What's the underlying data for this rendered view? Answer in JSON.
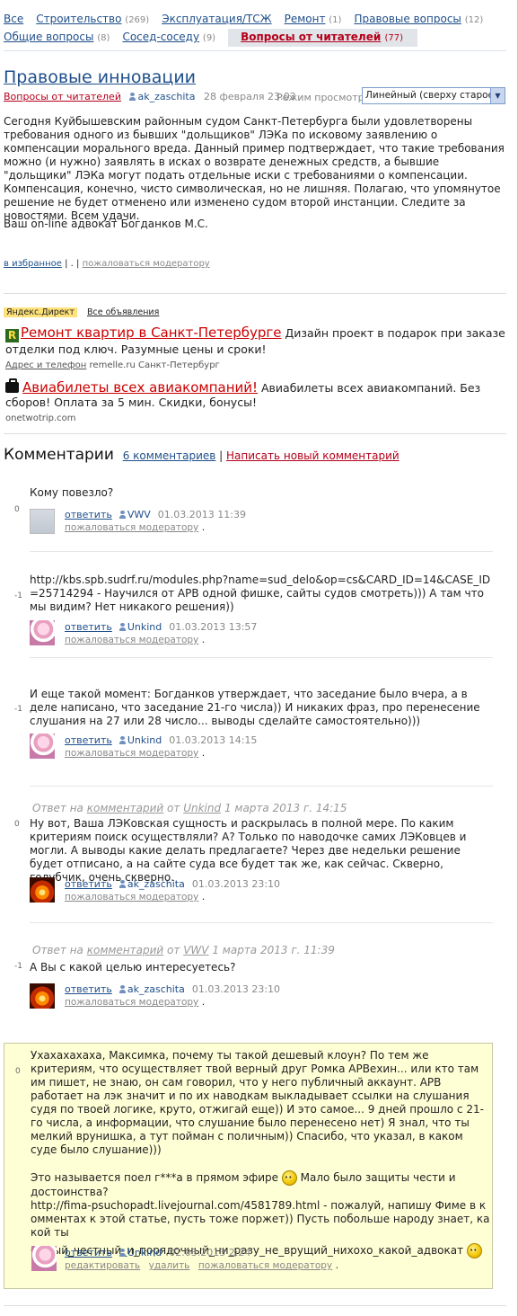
{
  "nav": {
    "items": [
      {
        "label": "Все",
        "count": ""
      },
      {
        "label": "Строительство",
        "count": "(269)"
      },
      {
        "label": "Эксплуатация/ТСЖ",
        "count": ""
      },
      {
        "label": "Ремонт",
        "count": "(1)"
      },
      {
        "label": "Правовые вопросы",
        "count": "(12)"
      },
      {
        "label": "Общие вопросы",
        "count": "(8)"
      },
      {
        "label": "Сосед-соседу",
        "count": "(9)"
      },
      {
        "label": "Вопросы от читателей",
        "count": "(77)"
      }
    ]
  },
  "article": {
    "title": "Правовые инновации",
    "rubric": "Вопросы от читателей",
    "author": "ak_zaschita",
    "date": "28 февраля 23:03",
    "view_mode_label": "Режим просмотра:",
    "view_mode_value": "Линейный (сверху старое)",
    "body": "Сегодня Куйбышевским районным судом Санкт-Петербурга были удовлетворены требования одного из бывших \"дольщиков\" ЛЭКа по исковому заявлению о компенсации морального вреда. Данный пример подтверждает, что такие требования можно (и нужно) заявлять в исках о возврате денежных средств, а бывшие \"дольщики\" ЛЭКа могут подать отдельные иски с требованиями о компенсации. Компенсация, конечно, чисто символическая, но не лишняя. Полагаю, что упомянутое решение не будет отменено или изменено судом второй инстанции. Следите за новостями. Всем удачи.",
    "signature": "Ваш on-line адвокат Богданков М.С.",
    "favorite_link": "в избранное",
    "sep1": "|",
    "dot": ".",
    "sep2": "|",
    "report_link": "пожаловаться модератору"
  },
  "ads": {
    "header": "Яндекс.Директ",
    "all_ads": "Все объявления",
    "items": [
      {
        "icon": "r-logo-icon",
        "title": "Ремонт квартир в Санкт-Петербурге",
        "text": "Дизайн проект в подарок при заказе отделки под ключ. Разумные цены и сроки!",
        "sub_link": "Адрес и телефон",
        "domain": "remelle.ru Санкт-Петербург"
      },
      {
        "icon": "briefcase-icon",
        "title": "Авиабилеты всех авиакомпаний!",
        "text": "Авиабилеты всех авиакомпаний. Без сборов! Оплата за 5 мин. Скидки, бонусы!",
        "sub_link": "",
        "domain": "onetwotrip.com"
      }
    ]
  },
  "comments_head": {
    "title": "Комментарии",
    "count_link": "6 комментариев",
    "sep": "|",
    "write_link": "Написать новый комментарий"
  },
  "comments": [
    {
      "score": "0",
      "reply_to": "",
      "text": "Кому повезло?",
      "reply": "ответить",
      "user": "VWV",
      "date": "01.03.2013 11:39",
      "report": "пожаловаться модератору",
      "dot": "."
    },
    {
      "score": "-1",
      "reply_to": "",
      "text": "http://kbs.spb.sudrf.ru/modules.php?name=sud_delo&op=cs&CARD_ID=14&CASE_ID=25714294 - Научился от АРВ одной фишке, сайты судов смотреть))) А там что мы видим? Нет никакого решения))",
      "reply": "ответить",
      "user": "Unkind",
      "date": "01.03.2013 13:57",
      "report": "пожаловаться модератору",
      "dot": "."
    },
    {
      "score": "-1",
      "reply_to": "",
      "text": "И еще такой момент: Богданков утверждает, что заседание было вчера, а в деле написано, что заседание 21-го числа)) И никаких фраз, про перенесение слушания на 27 или 28 число... выводы сделайте самостоятельно)))",
      "reply": "ответить",
      "user": "Unkind",
      "date": "01.03.2013 14:15",
      "report": "пожаловаться модератору",
      "dot": "."
    },
    {
      "score": "0",
      "reply_to": {
        "prefix": "Ответ на",
        "link": "комментарий",
        "from": "от",
        "user": "Unkind",
        "date": "1 марта 2013 г. 14:15"
      },
      "text": "Ну вот, Ваша ЛЭКовская сущность и раскрылась в полной мере. По каким критериям поиск осуществляли? А? Только по наводочке самих ЛЭКовцев и могли. А выводы какие делать предлагаете? Через две недельки решение будет отписано, а на сайте суда все будет так же, как сейчас. Скверно, голубчик, очень скверно.",
      "reply": "ответить",
      "user": "ak_zaschita",
      "date": "01.03.2013 23:10",
      "report": "пожаловаться модератору",
      "dot": "."
    },
    {
      "score": "-1",
      "reply_to": {
        "prefix": "Ответ на",
        "link": "комментарий",
        "from": "от",
        "user": "VWV",
        "date": "1 марта 2013 г. 11:39"
      },
      "text": "А Вы с какой целью интересуетесь?",
      "reply": "ответить",
      "user": "ak_zaschita",
      "date": "01.03.2013 23:10",
      "report": "пожаловаться модератору",
      "dot": "."
    }
  ],
  "own_comment": {
    "score": "0",
    "text1": "Ухахахахаха, Максимка, почему ты такой дешевый клоун? По тем же критериям, что осуществляет твой верный друг Ромка АРВехин... или кто там им пишет, не знаю, он сам говорил, что у него публичный аккаунт. АРВ работает на лэк значит и по их наводкам выкладывает ссылки на слушания судя по твоей логике, круто, отжигай еще)) И это самое... 9 дней прошло с 21-го числа, а информации, что слушание было перенесено нет) Я знал, что ты мелкий врунишка, а тут пойман с поличным)) Спасибо, что указал, в каком суде было слушание)))",
    "text2a": "Это называется поел г***а в прямом эфире",
    "text2b": "Мало было защиты чести и достоинства?",
    "text3": "http://fima-psuchopadt.livejournal.com/4581789.html - пожалуй, напишу Фиме в комментах к этой статье, пусть тоже поржет)) Пусть побольше народу знает, какой ты",
    "text4": "Самый_честный_и_порядочный_ни_разу_не_врущий_нихохо_какой_адвокат",
    "reply": "ответить",
    "user": "Unkind",
    "date": "02.03.2013 2:24",
    "edit": "редактировать",
    "delete": "удалить",
    "report": "пожаловаться модератору",
    "dot": "."
  }
}
